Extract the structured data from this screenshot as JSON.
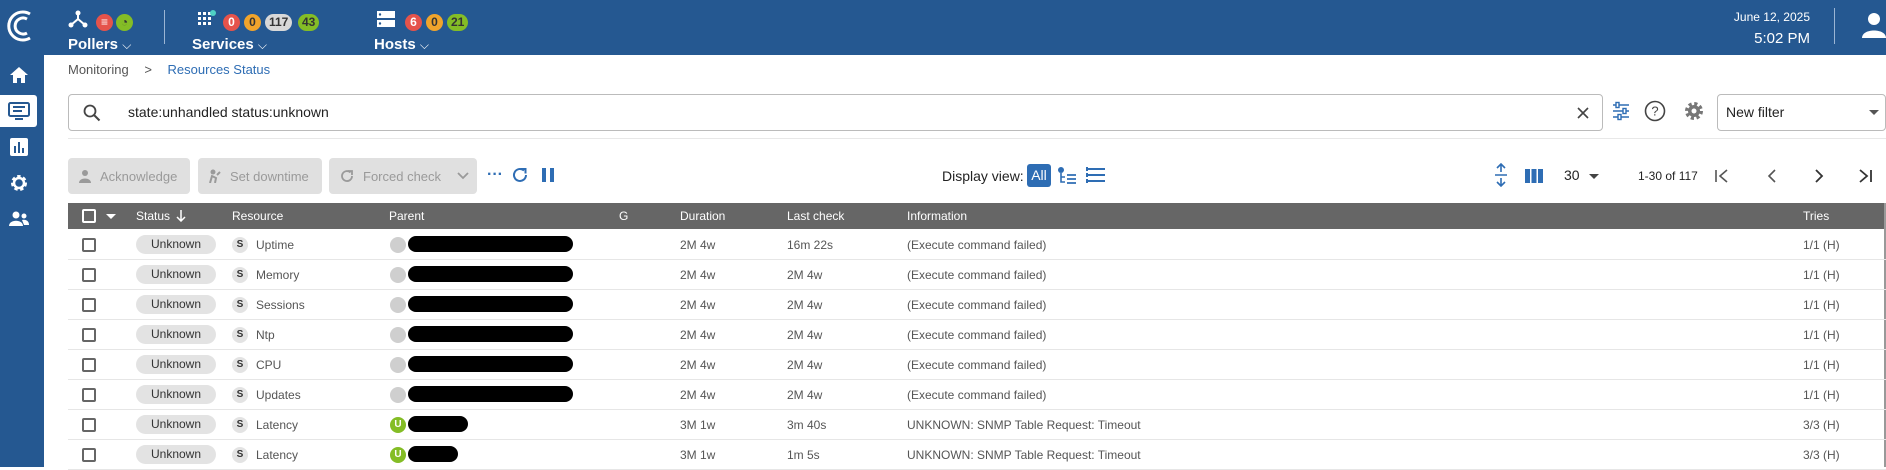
{
  "header": {
    "pollers": {
      "label": "Pollers",
      "icon": "pollers-icon"
    },
    "services": {
      "label": "Services",
      "counts": [
        "0",
        "0",
        "117",
        "43"
      ]
    },
    "hosts": {
      "label": "Hosts",
      "counts": [
        "6",
        "0",
        "21"
      ]
    },
    "date": "June 12, 2025",
    "time": "5:02 PM"
  },
  "breadcrumb": {
    "parent": "Monitoring",
    "sep": ">",
    "current": "Resources Status"
  },
  "search": {
    "value": "state:unhandled status:unknown"
  },
  "filter": {
    "selected": "New filter"
  },
  "actions": {
    "acknowledge": "Acknowledge",
    "set_downtime": "Set downtime",
    "forced_check": "Forced check",
    "more": "···",
    "display_view_label": "Display view:",
    "display_all": "All",
    "rows_per_page": "30",
    "pagination": "1-30 of 117"
  },
  "table": {
    "columns": {
      "status": "Status",
      "resource": "Resource",
      "parent": "Parent",
      "g": "G",
      "duration": "Duration",
      "last_check": "Last check",
      "information": "Information",
      "tries": "Tries"
    },
    "rows": [
      {
        "status": "Unknown",
        "type": "S",
        "resource": "Uptime",
        "parent_icon": "grey",
        "duration": "2M 4w",
        "last_check": "16m 22s",
        "information": "(Execute command failed)",
        "tries": "1/1 (H)"
      },
      {
        "status": "Unknown",
        "type": "S",
        "resource": "Memory",
        "parent_icon": "grey",
        "duration": "2M 4w",
        "last_check": "2M 4w",
        "information": "(Execute command failed)",
        "tries": "1/1 (H)"
      },
      {
        "status": "Unknown",
        "type": "S",
        "resource": "Sessions",
        "parent_icon": "grey",
        "duration": "2M 4w",
        "last_check": "2M 4w",
        "information": "(Execute command failed)",
        "tries": "1/1 (H)"
      },
      {
        "status": "Unknown",
        "type": "S",
        "resource": "Ntp",
        "parent_icon": "grey",
        "duration": "2M 4w",
        "last_check": "2M 4w",
        "information": "(Execute command failed)",
        "tries": "1/1 (H)"
      },
      {
        "status": "Unknown",
        "type": "S",
        "resource": "CPU",
        "parent_icon": "grey",
        "duration": "2M 4w",
        "last_check": "2M 4w",
        "information": "(Execute command failed)",
        "tries": "1/1 (H)"
      },
      {
        "status": "Unknown",
        "type": "S",
        "resource": "Updates",
        "parent_icon": "grey",
        "duration": "2M 4w",
        "last_check": "2M 4w",
        "information": "(Execute command failed)",
        "tries": "1/1 (H)"
      },
      {
        "status": "Unknown",
        "type": "S",
        "resource": "Latency",
        "parent_icon": "U",
        "duration": "3M 1w",
        "last_check": "3m 40s",
        "information": "UNKNOWN: SNMP Table Request: Timeout",
        "tries": "3/3 (H)"
      },
      {
        "status": "Unknown",
        "type": "S",
        "resource": "Latency",
        "parent_icon": "U",
        "duration": "3M 1w",
        "last_check": "1m 5s",
        "information": "UNKNOWN: SNMP Table Request: Timeout",
        "tries": "3/3 (H)"
      }
    ]
  },
  "colors": {
    "header_bg": "#255891",
    "accent": "#2e6db4",
    "status_unknown_bg": "#e3e3e3",
    "pill_red": "#e5534b",
    "pill_orange": "#f0a42c",
    "pill_green": "#84bd26"
  }
}
